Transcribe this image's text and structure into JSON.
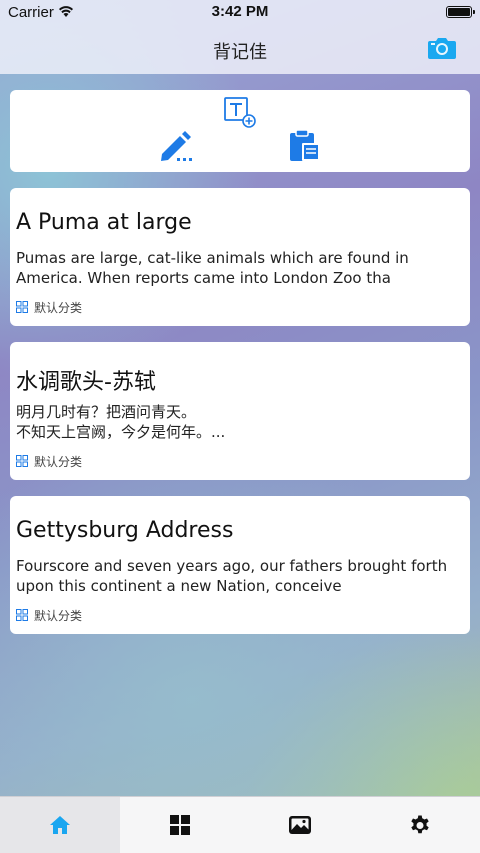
{
  "status_bar": {
    "carrier": "Carrier",
    "time": "3:42 PM"
  },
  "nav": {
    "title": "背记佳"
  },
  "colors": {
    "accent": "#1e7be6",
    "camera": "#1aa8f0",
    "tab_active": "#19a6f0"
  },
  "toolbar": {
    "icons": [
      "text-add-icon",
      "pen-icon",
      "clipboard-icon"
    ]
  },
  "notes": [
    {
      "title": "A Puma at large",
      "body": "Pumas are large, cat-like animals which are found in\nAmerica. When reports came into London Zoo tha",
      "category": "默认分类"
    },
    {
      "title": "水调歌头-苏轼",
      "body": "明月几时有？把酒问青天。\n不知天上宫阙，今夕是何年。...",
      "category": "默认分类"
    },
    {
      "title": "Gettysburg Address",
      "body": "Fourscore and seven years ago, our fathers brought forth\nupon this continent a new Nation, conceive",
      "category": "默认分类"
    }
  ],
  "tabs": [
    {
      "icon": "home-icon",
      "active": true
    },
    {
      "icon": "grid-icon",
      "active": false
    },
    {
      "icon": "photo-icon",
      "active": false
    },
    {
      "icon": "gear-icon",
      "active": false
    }
  ]
}
